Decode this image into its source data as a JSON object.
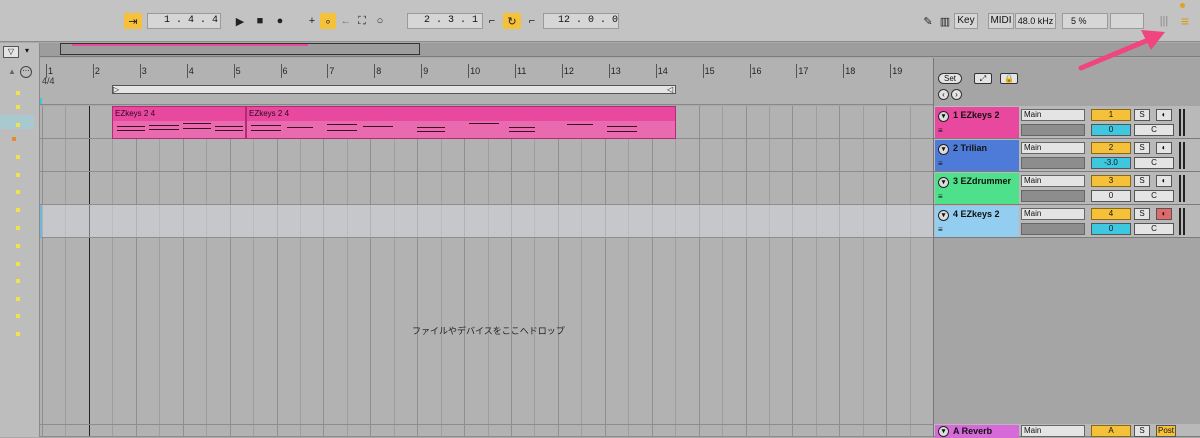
{
  "transport": {
    "position": "1 .  4 .  4",
    "loop_start": "2 .  3 .  1",
    "loop_length": "12 .  0 .  0"
  },
  "status": {
    "key_label": "Key",
    "midi_label": "MIDI",
    "sample_rate": "48.0 kHz",
    "cpu": "5 %"
  },
  "ruler": {
    "time_signature": "4/4",
    "bars": [
      "1",
      "2",
      "3",
      "4",
      "5",
      "6",
      "7",
      "8",
      "9",
      "10",
      "11",
      "12",
      "13",
      "14",
      "15",
      "16",
      "17",
      "18",
      "19"
    ]
  },
  "set_controls": {
    "set_label": "Set"
  },
  "clips": [
    {
      "name": "EZkeys 2 4"
    },
    {
      "name": "EZkeys 2 4"
    }
  ],
  "drop_hint": "ファイルやデバイスをここへドロップ",
  "tracks": [
    {
      "name": "1 EZkeys 2",
      "color": "#e8489e",
      "route": "Main",
      "arm": "1",
      "volume": "0",
      "solo": "S",
      "pan": "C",
      "vol_color": "#3ec8e0"
    },
    {
      "name": "2 Trilian",
      "color": "#4f7bd8",
      "route": "Main",
      "arm": "2",
      "volume": "-3.0",
      "solo": "S",
      "pan": "C",
      "vol_color": "#3ec8e0"
    },
    {
      "name": "3 EZdrummer",
      "color": "#4ee08a",
      "route": "Main",
      "arm": "3",
      "volume": "0",
      "solo": "S",
      "pan": "C",
      "vol_color": "#e4e4e4"
    },
    {
      "name": "4 EZkeys 2",
      "color": "#93cdf0",
      "route": "Main",
      "arm": "4",
      "volume": "0",
      "solo": "S",
      "pan": "C",
      "vol_color": "#3ec8e0"
    }
  ],
  "return_track": {
    "name": "A Reverb",
    "color": "#d56ad8",
    "route": "Main",
    "arm": "A",
    "solo": "S",
    "post": "Post"
  },
  "colors": {
    "accent": "#f5c13a",
    "arrow": "#f0457e"
  }
}
